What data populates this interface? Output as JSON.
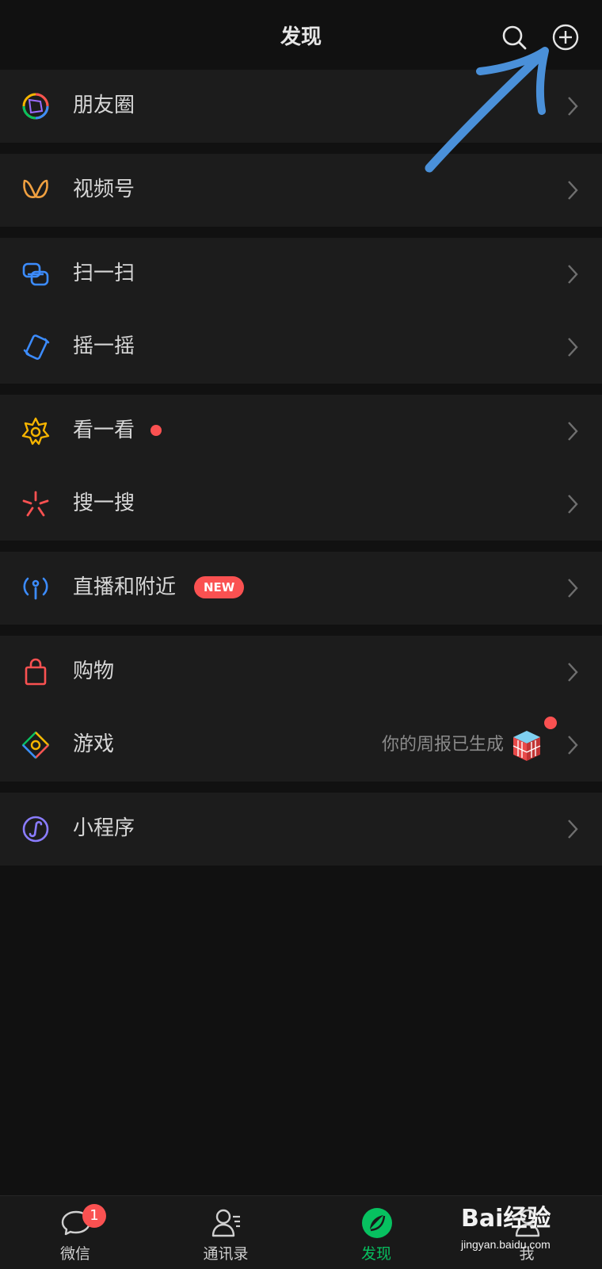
{
  "header": {
    "title": "发现"
  },
  "menu": {
    "moments": "朋友圈",
    "channels": "视频号",
    "scan": "扫一扫",
    "shake": "摇一摇",
    "top_stories": "看一看",
    "search": "搜一搜",
    "live_nearby": "直播和附近",
    "live_badge": "NEW",
    "shopping": "购物",
    "games": "游戏",
    "games_note": "你的周报已生成",
    "mini_programs": "小程序"
  },
  "tabbar": {
    "chats": "微信",
    "chats_badge": "1",
    "contacts": "通讯录",
    "discover": "发现",
    "me": "我"
  },
  "watermark": {
    "logo": "Bai经验",
    "url": "jingyan.baidu.com"
  },
  "colors": {
    "accent_green": "#07c160",
    "badge_red": "#fa5151",
    "annotation_arrow": "#4a90d9"
  }
}
